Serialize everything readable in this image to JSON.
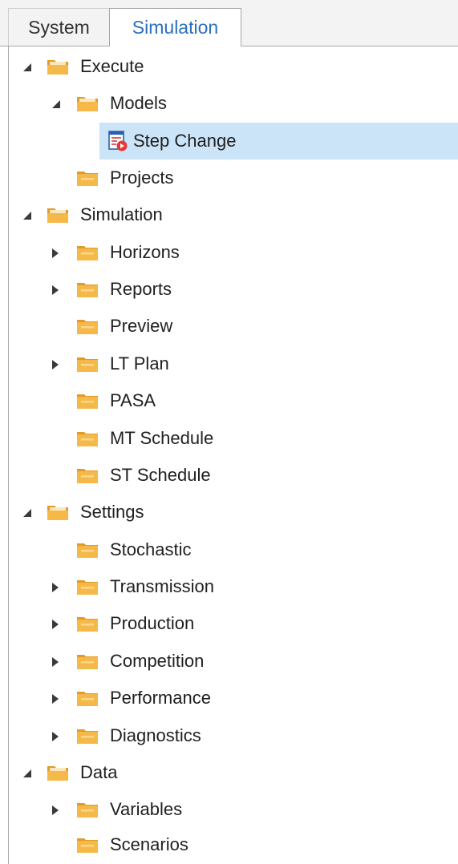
{
  "tabs": {
    "system": "System",
    "simulation": "Simulation"
  },
  "colors": {
    "accent": "#2a6fc0",
    "selection": "#cce4f7",
    "folder": "#f5b94a",
    "folder_dark": "#e49a24"
  },
  "tree": {
    "execute": {
      "label": "Execute",
      "models": {
        "label": "Models",
        "step_change": "Step Change"
      },
      "projects": "Projects"
    },
    "simulation": {
      "label": "Simulation",
      "horizons": "Horizons",
      "reports": "Reports",
      "preview": "Preview",
      "lt_plan": "LT Plan",
      "pasa": "PASA",
      "mt_schedule": "MT Schedule",
      "st_schedule": "ST Schedule"
    },
    "settings": {
      "label": "Settings",
      "stochastic": "Stochastic",
      "transmission": "Transmission",
      "production": "Production",
      "competition": "Competition",
      "performance": "Performance",
      "diagnostics": "Diagnostics"
    },
    "data": {
      "label": "Data",
      "variables": "Variables",
      "scenarios": "Scenarios"
    }
  }
}
